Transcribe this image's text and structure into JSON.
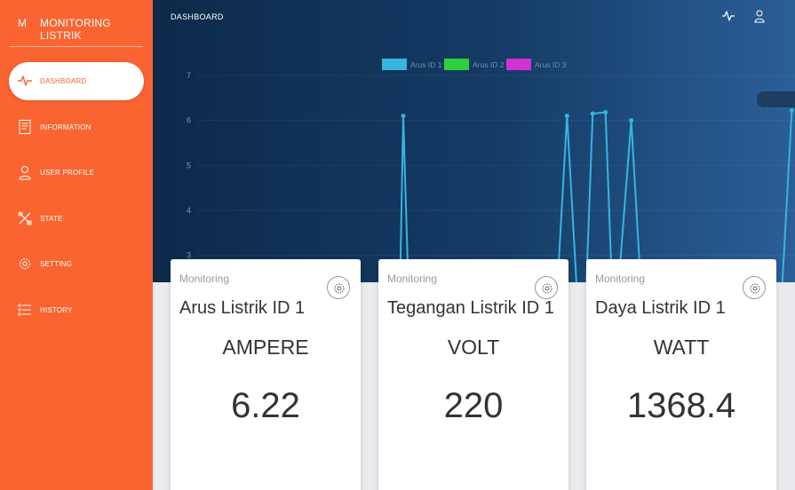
{
  "brand": {
    "mini": "M",
    "name": "MONITORING LISTRIK"
  },
  "sidebar": {
    "items": [
      {
        "label": "DASHBOARD",
        "icon": "pulse-icon",
        "active": true
      },
      {
        "label": "INFORMATION",
        "icon": "document-icon"
      },
      {
        "label": "USER PROFILE",
        "icon": "user-icon"
      },
      {
        "label": "STATE",
        "icon": "tools-icon"
      },
      {
        "label": "SETTING",
        "icon": "gear-icon"
      },
      {
        "label": "HISTORY",
        "icon": "list-icon"
      }
    ]
  },
  "header": {
    "title": "DASHBOARD",
    "icons": [
      "pulse-icon",
      "user-icon"
    ]
  },
  "chart_data": {
    "type": "line",
    "legend": [
      "Arus ID 1",
      "Arus ID 2",
      "Arus ID 3"
    ],
    "legend_colors": [
      "#36b5e0",
      "#2fd13a",
      "#d132d1"
    ],
    "y_ticks": [
      "7",
      "6",
      "5",
      "4",
      "3"
    ],
    "ylim": [
      2.4,
      7
    ],
    "series": [
      {
        "name": "Arus ID 1",
        "color": "#36b5e0",
        "points": [
          [
            0.385,
            2.3
          ],
          [
            0.39,
            6.1
          ],
          [
            0.398,
            2.3
          ],
          [
            0.63,
            2.3
          ],
          [
            0.645,
            6.1
          ],
          [
            0.66,
            2.3
          ],
          [
            0.675,
            2.3
          ],
          [
            0.685,
            6.15
          ],
          [
            0.705,
            6.18
          ],
          [
            0.715,
            2.3
          ],
          [
            0.725,
            2.3
          ],
          [
            0.745,
            6.0
          ],
          [
            0.76,
            2.3
          ],
          [
            0.98,
            2.3
          ],
          [
            0.995,
            6.22
          ]
        ]
      },
      {
        "name": "Arus ID 2",
        "color": "#2fd13a",
        "points": []
      },
      {
        "name": "Arus ID 3",
        "color": "#d132d1",
        "points": []
      }
    ]
  },
  "cards": [
    {
      "category": "Monitoring",
      "title": "Arus Listrik ID 1",
      "unit": "AMPERE",
      "value": "6.22"
    },
    {
      "category": "Monitoring",
      "title": "Tegangan Listrik ID 1",
      "unit": "VOLT",
      "value": "220"
    },
    {
      "category": "Monitoring",
      "title": "Daya Listrik ID 1",
      "unit": "WATT",
      "value": "1368.4"
    }
  ]
}
